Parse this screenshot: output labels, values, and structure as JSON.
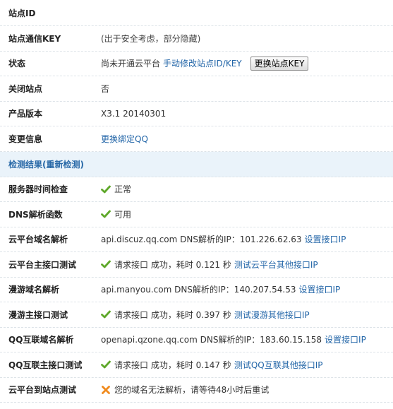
{
  "info": {
    "site_id": {
      "label": "站点ID",
      "value": ""
    },
    "site_key": {
      "label": "站点通信KEY",
      "value": "(出于安全考虑，部分隐藏)"
    },
    "status": {
      "label": "状态",
      "text": "尚未开通云平台",
      "link": "手动修改站点ID/KEY",
      "button": "更换站点KEY"
    },
    "close_site": {
      "label": "关闭站点",
      "value": "否"
    },
    "version": {
      "label": "产品版本",
      "value": "X3.1 20140301"
    },
    "change": {
      "label": "变更信息",
      "link": "更换绑定QQ"
    }
  },
  "check": {
    "title": "检测结果(重新检测)",
    "rows": [
      {
        "label": "服务器时间检查",
        "icon": "check-icon",
        "text": "正常"
      },
      {
        "label": "DNS解析函数",
        "icon": "check-icon",
        "text": "可用"
      },
      {
        "label": "云平台域名解析",
        "text": "api.discuz.qq.com DNS解析的IP：101.226.62.63",
        "link": "设置接口IP"
      },
      {
        "label": "云平台主接口测试",
        "icon": "check-icon",
        "text": "请求接口 成功，耗时 0.121 秒",
        "link": "测试云平台其他接口IP"
      },
      {
        "label": "漫游域名解析",
        "text": "api.manyou.com DNS解析的IP：140.207.54.53",
        "link": "设置接口IP"
      },
      {
        "label": "漫游主接口测试",
        "icon": "check-icon",
        "text": "请求接口 成功，耗时 0.397 秒",
        "link": "测试漫游其他接口IP"
      },
      {
        "label": "QQ互联域名解析",
        "text": "openapi.qzone.qq.com DNS解析的IP：183.60.15.158",
        "link": "设置接口IP"
      },
      {
        "label": "QQ互联主接口测试",
        "icon": "check-icon",
        "text": "请求接口 成功，耗时 0.147 秒",
        "link": "测试QQ互联其他接口IP"
      },
      {
        "label": "云平台到站点测试",
        "icon": "error-x-icon",
        "text": "您的域名无法解析，请等待48小时后重试"
      }
    ]
  },
  "colors": {
    "link": "#2366a8",
    "check": "#5fa82a",
    "error": "#f08a1c",
    "section_bg": "#eaf3fa"
  }
}
